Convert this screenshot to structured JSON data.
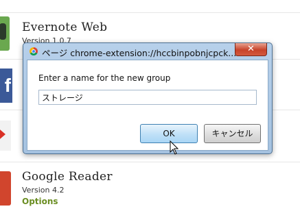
{
  "extensions": [
    {
      "name": "Evernote Web",
      "version": "Version 1.0.7"
    },
    {
      "name": "Google Reader",
      "version": "Version 4.2",
      "options": "Options"
    }
  ],
  "dialog": {
    "title": "ページ chrome-extension://hccbinpobnjcpck...",
    "close_label": "✕",
    "prompt": "Enter a name for the new group",
    "input_value": "ストレージ",
    "ok_label": "OK",
    "cancel_label": "キャンセル"
  },
  "icons": [
    "evernote-icon",
    "facebook-icon",
    "gmail-icon",
    "google-reader-icon",
    "chrome-icon",
    "mouse-pointer-icon"
  ]
}
